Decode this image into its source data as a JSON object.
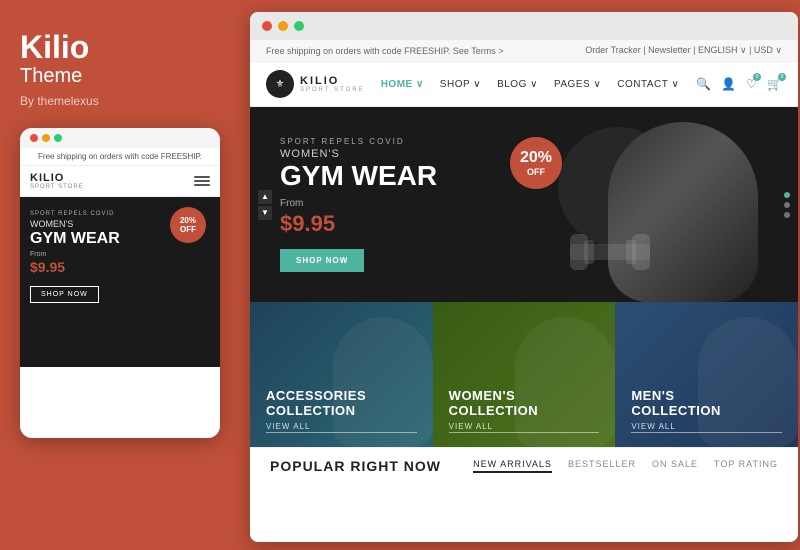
{
  "left": {
    "brand": "Kilio",
    "theme": "Theme",
    "by": "By themelexus"
  },
  "mobile": {
    "notice": "Free shipping on orders with code FREESHIP.",
    "logo": "KILIO",
    "logo_sub": "SPORT STORE",
    "badge": "20%\nOFF",
    "sport_label": "SPORT REPELS COVID",
    "gym_line1": "WOMEN'S",
    "gym_title": "GYM WEAR",
    "from": "From",
    "price": "$9.95",
    "shop_btn": "SHOP NOW"
  },
  "browser": {
    "notice_left": "Free shipping on orders with code FREESHIP. See Terms  >",
    "notice_right": "Order Tracker  |  Newsletter  |  ENGLISH ∨  |  USD ∨",
    "logo": "KILIO",
    "logo_sub": "SPORT STORE",
    "nav": {
      "items": [
        {
          "label": "HOME",
          "active": true
        },
        {
          "label": "SHOP",
          "active": false
        },
        {
          "label": "BLOG",
          "active": false
        },
        {
          "label": "PAGES",
          "active": false
        },
        {
          "label": "CONTACT",
          "active": false
        }
      ]
    },
    "hero": {
      "sport_label": "SPORT REPELS COVID",
      "subtitle": "WOMEN'S",
      "title": "GYM WEAR",
      "from": "From",
      "price": "$9.95",
      "shop_btn": "SHOP NOW",
      "badge_pct": "20%",
      "badge_off": "OFF"
    },
    "collections": [
      {
        "title": "ACCESSORIES\nCOLLECTION",
        "link": "VIEW ALL"
      },
      {
        "title": "WOMEN'S\nCOLLECTION",
        "link": "VIEW ALL"
      },
      {
        "title": "MEN'S\nCOLLECTION",
        "link": "VIEW ALL"
      }
    ],
    "bottom": {
      "title": "POPULAR RIGHT NOW",
      "tabs": [
        {
          "label": "NEW ARRIVALS",
          "active": true
        },
        {
          "label": "BESTSELLER",
          "active": false
        },
        {
          "label": "ON SALE",
          "active": false
        },
        {
          "label": "TOP RATING",
          "active": false
        }
      ]
    }
  },
  "colors": {
    "accent": "#c0503a",
    "teal": "#4eb5a0",
    "dark": "#1a1a1a",
    "dot1": "#e74c3c",
    "dot2": "#f39c12",
    "dot3": "#2ecc71"
  }
}
